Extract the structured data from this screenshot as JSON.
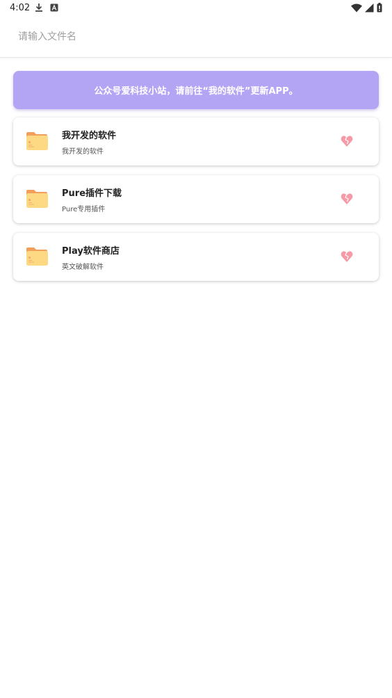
{
  "status_bar": {
    "time": "4:02",
    "icons": [
      "download-icon",
      "app-a-icon",
      "wifi-icon",
      "signal-icon",
      "battery-icon"
    ]
  },
  "search": {
    "placeholder": "请输入文件名",
    "value": ""
  },
  "banner": {
    "text": "公众号爱科技小站，请前往“我的软件”更新APP。",
    "color": "#b4a4f4"
  },
  "items": [
    {
      "title": "我开发的软件",
      "subtitle": "我开发的软件",
      "icon": "folder-icon",
      "action_icon": "heart-icon"
    },
    {
      "title": "Pure插件下载",
      "subtitle": "Pure专用插件",
      "icon": "folder-icon",
      "action_icon": "heart-icon"
    },
    {
      "title": "Play软件商店",
      "subtitle": "英文破解软件",
      "icon": "folder-icon",
      "action_icon": "heart-icon"
    }
  ],
  "colors": {
    "folder": "#fcd982",
    "folder_tab": "#f29f5c",
    "heart": "#f59aa6"
  }
}
